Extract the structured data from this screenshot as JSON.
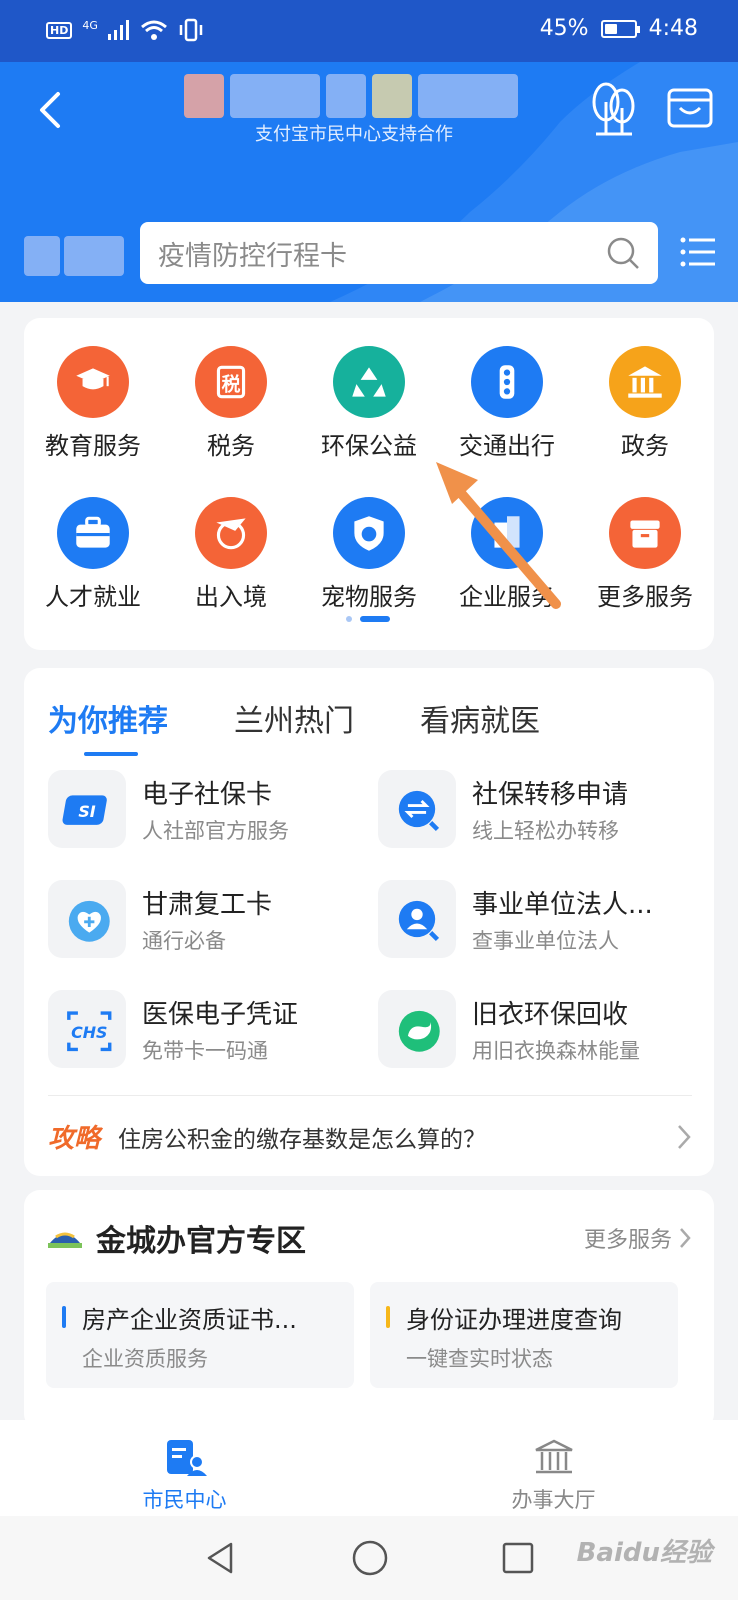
{
  "status_bar": {
    "hd": "HD",
    "network": "4G",
    "battery": "45%",
    "battery_level": 0.45,
    "time": "4:48"
  },
  "header": {
    "subtitle": "支付宝市民中心支持合作",
    "search_placeholder": "疫情防控行程卡",
    "colors": {
      "status_bar": "#1f57c8",
      "header": "#1e7bf3"
    }
  },
  "services": [
    {
      "label": "教育服务",
      "icon": "graduation-cap-icon",
      "color": "#f46437"
    },
    {
      "label": "税务",
      "icon": "tax-icon",
      "color": "#f46437"
    },
    {
      "label": "环保公益",
      "icon": "recycle-icon",
      "color": "#16b19c"
    },
    {
      "label": "交通出行",
      "icon": "traffic-light-icon",
      "color": "#1e7bf3"
    },
    {
      "label": "政务",
      "icon": "government-building-icon",
      "color": "#f6a31a"
    },
    {
      "label": "人才就业",
      "icon": "briefcase-icon",
      "color": "#1e7bf3"
    },
    {
      "label": "出入境",
      "icon": "plane-globe-icon",
      "color": "#f46437"
    },
    {
      "label": "宠物服务",
      "icon": "pet-shield-icon",
      "color": "#1e7bf3"
    },
    {
      "label": "企业服务",
      "icon": "office-building-icon",
      "color": "#1e7bf3"
    },
    {
      "label": "更多服务",
      "icon": "box-icon",
      "color": "#f46437"
    }
  ],
  "recommend": {
    "tabs": [
      "为你推荐",
      "兰州热门",
      "看病就医"
    ],
    "items": [
      {
        "title": "电子社保卡",
        "subtitle": "人社部官方服务",
        "icon": "social-security-card-icon"
      },
      {
        "title": "社保转移申请",
        "subtitle": "线上轻松办转移",
        "icon": "transfer-search-icon"
      },
      {
        "title": "甘肃复工卡",
        "subtitle": "通行必备",
        "icon": "heart-plus-icon"
      },
      {
        "title": "事业单位法人...",
        "subtitle": "查事业单位法人",
        "icon": "person-search-icon"
      },
      {
        "title": "医保电子凭证",
        "subtitle": "免带卡一码通",
        "icon": "chs-scan-icon"
      },
      {
        "title": "旧衣环保回收",
        "subtitle": "用旧衣换森林能量",
        "icon": "whale-icon"
      }
    ],
    "tip_tag": "攻略",
    "tip_text": "住房公积金的缴存基数是怎么算的？"
  },
  "official": {
    "title": "金城办官方专区",
    "more": "更多服务",
    "items": [
      {
        "title": "房产企业资质证书...",
        "subtitle": "企业资质服务",
        "color": "#1e7bf3"
      },
      {
        "title": "身份证办理进度查询",
        "subtitle": "一键查实时状态",
        "color": "#f6b71a"
      }
    ]
  },
  "bottom_nav": [
    {
      "label": "市民中心",
      "icon": "citizen-doc-icon",
      "active": true
    },
    {
      "label": "办事大厅",
      "icon": "hall-building-icon",
      "active": false
    }
  ],
  "watermark": "Baidu经验"
}
